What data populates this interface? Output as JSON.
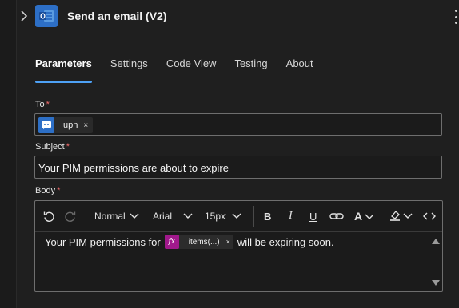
{
  "header": {
    "title": "Send an email (V2)",
    "icons": {
      "expand": "chevron-right-icon",
      "app": "outlook-icon",
      "more": "kebab-menu-icon"
    },
    "accent": "#2d6fc6"
  },
  "tabs": [
    {
      "label": "Parameters",
      "active": true
    },
    {
      "label": "Settings",
      "active": false
    },
    {
      "label": "Code View",
      "active": false
    },
    {
      "label": "Testing",
      "active": false
    },
    {
      "label": "About",
      "active": false
    }
  ],
  "fields": {
    "to": {
      "label": "To",
      "required_mark": "*",
      "chip": {
        "label": "upn",
        "icon": "dynamic-content-icon",
        "close": "×"
      }
    },
    "subject": {
      "label": "Subject",
      "required_mark": "*",
      "value": "Your PIM permissions are about to expire"
    },
    "body": {
      "label": "Body",
      "required_mark": "*",
      "toolbar": {
        "undo": "undo-icon",
        "redo": "redo-icon",
        "paragraph_style": "Normal",
        "font_family": "Arial",
        "font_size": "15px",
        "bold": "B",
        "italic": "I",
        "underline": "U",
        "link": "link-icon",
        "font_color": "A",
        "highlight": "highlight-icon",
        "code": "code-view-icon"
      },
      "content": {
        "text_before": "Your PIM permissions for",
        "expression": {
          "icon_text": "fx",
          "label": "items(...)",
          "close": "×"
        },
        "text_after": "will be expiring soon."
      }
    }
  },
  "colors": {
    "active_tab_underline": "#4ea1f5",
    "required": "#f06a6a",
    "expression": "#a1198c"
  }
}
